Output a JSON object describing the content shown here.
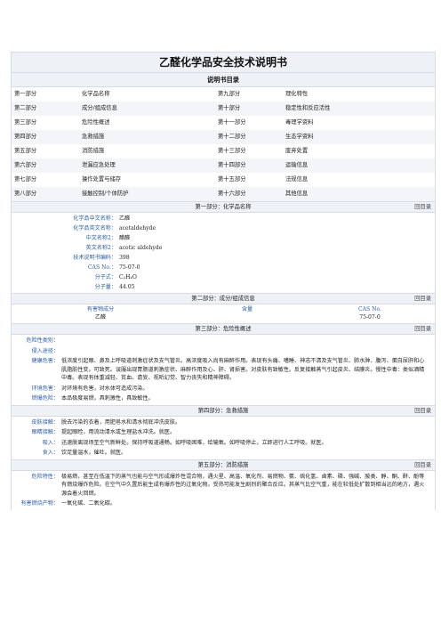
{
  "title": "乙醛化学品安全技术说明书",
  "toc_title": "说明书目录",
  "toc": [
    [
      "第一部分",
      "化学品名称",
      "第九部分",
      "理化特性"
    ],
    [
      "第二部分",
      "成分/组成信息",
      "第十部分",
      "稳定性和反应活性"
    ],
    [
      "第三部分",
      "危险性概述",
      "第十一部分",
      "毒理学资料"
    ],
    [
      "第四部分",
      "急救措施",
      "第十二部分",
      "生态学资料"
    ],
    [
      "第五部分",
      "消防措施",
      "第十三部分",
      "废弃处置"
    ],
    [
      "第六部分",
      "泄漏应急处理",
      "第十四部分",
      "运输信息"
    ],
    [
      "第七部分",
      "操作处置与储存",
      "第十五部分",
      "法规信息"
    ],
    [
      "第八部分",
      "接触控制/个体防护",
      "第十六部分",
      "其他信息"
    ]
  ],
  "back_label": "回目录",
  "s1": {
    "title": "第一部分：化学品名称",
    "rows": [
      [
        "化学品中文名称：",
        "乙醛"
      ],
      [
        "化学品英文名称：",
        "acetaldehyde"
      ],
      [
        "中文名称2：",
        "醋醛"
      ],
      [
        "英文名称2：",
        "acetic aldehyde"
      ],
      [
        "技术说明书编码：",
        "398"
      ],
      [
        "CAS No.：",
        "75-07-0"
      ],
      [
        "分子式：",
        "C₂H₄O"
      ],
      [
        "分子量：",
        "44.05"
      ]
    ]
  },
  "s2": {
    "title": "第二部分：成分/组成信息",
    "h1": "有害物成分",
    "h2": "含量",
    "h3": "CAS No.",
    "v1": "乙醛",
    "v2": "",
    "v3": "75-07-0"
  },
  "s3": {
    "title": "第三部分：危险性概述",
    "rows": [
      [
        "危险性类别：",
        ""
      ],
      [
        "侵入途径：",
        ""
      ],
      [
        "健康危害：",
        "低浓度引起眼、鼻及上呼吸道刺激症状及支气管炎。高浓度吸入尚有麻醉作用。表现有头痛、嗜睡、神志不清及支气管炎、肺水肿、腹泻、蛋白尿肝和心肌脂肪性变。可致死。误服出现胃肠道刺激症状、麻醉作用及心、肝、肾损害。对皮肤有致敏性。反复接触蒸气引起皮炎、结膜炎。慢性中毒：类似酒精中毒。表现有体重减轻、贫血、谵妄、视听幻觉、智力丧失和精神障碍。"
      ],
      [
        "环境危害：",
        "对环境有危害，对水体可造成污染。"
      ],
      [
        "燃爆危险：",
        "本品极度易燃，具刺激性，具致敏性。"
      ]
    ]
  },
  "s4": {
    "title": "第四部分：急救措施",
    "rows": [
      [
        "皮肤接触：",
        "脱去污染的衣着，用肥皂水和清水彻底冲洗皮肤。"
      ],
      [
        "眼睛接触：",
        "提起眼睑，用流动清水或生理盐水冲洗。就医。"
      ],
      [
        "吸入：",
        "迅速脱离现场至空气新鲜处。保持呼吸道通畅。如呼吸困难，给输氧。如呼吸停止，立即进行人工呼吸。就医。"
      ],
      [
        "食入：",
        "饮足量温水，催吐。就医。"
      ]
    ]
  },
  "s5": {
    "title": "第五部分：消防措施",
    "rows": [
      [
        "危险特性：",
        "极易燃，甚至在低温下的蒸气也能与空气形成爆炸性混合物，遇火星、高温、氧化剂、易燃物、氨、硫化氢、卤素、磷、强碱、胺类、醇、酮、酐、酚等有燃烧爆炸危险。在空气中久置后能生成有爆炸性的过氧化物。受热可能发生剧烈的聚合反应。其蒸气比空气重，能在较低处扩散到相当远的地方，遇火源会着火回燃。"
      ],
      [
        "有害燃烧产物：",
        "一氧化碳、二氧化碳。"
      ]
    ]
  }
}
